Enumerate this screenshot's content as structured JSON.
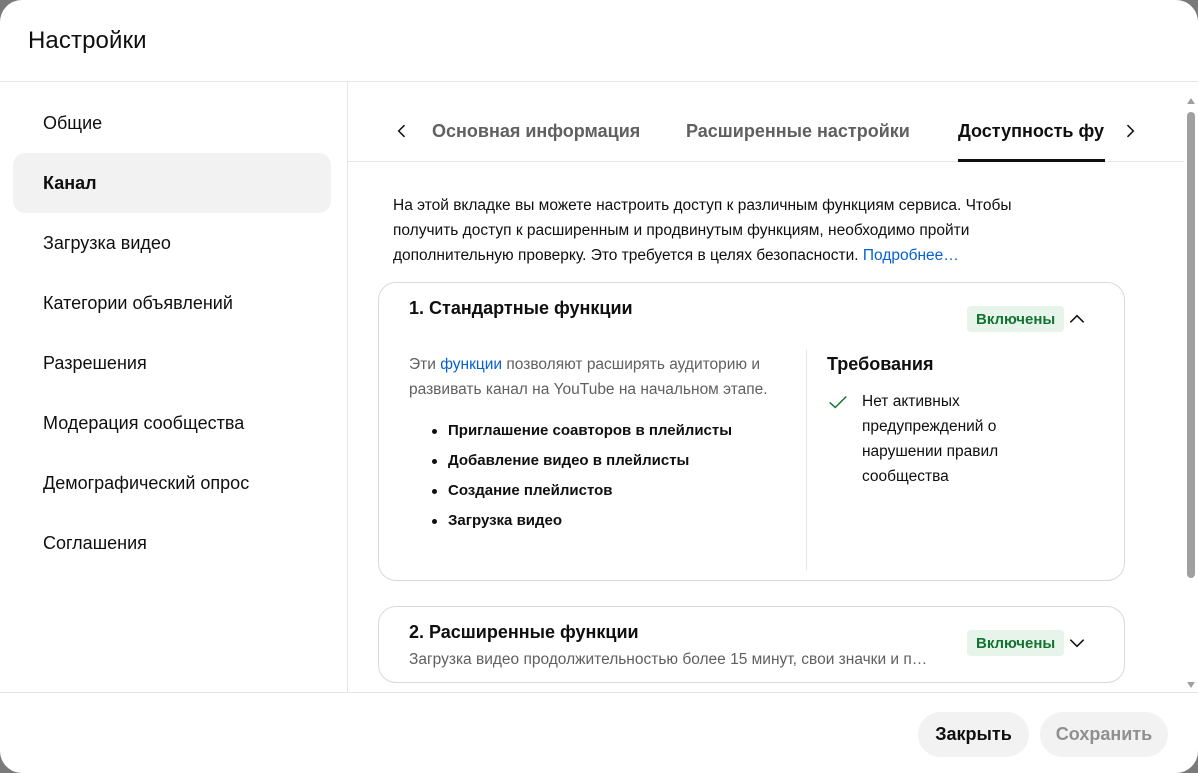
{
  "dialog": {
    "title": "Настройки"
  },
  "sidebar": {
    "items": [
      {
        "label": "Общие",
        "active": false
      },
      {
        "label": "Канал",
        "active": true
      },
      {
        "label": "Загрузка видео",
        "active": false
      },
      {
        "label": "Категории объявлений",
        "active": false
      },
      {
        "label": "Разрешения",
        "active": false
      },
      {
        "label": "Модерация сообщества",
        "active": false
      },
      {
        "label": "Демографический опрос",
        "active": false
      },
      {
        "label": "Соглашения",
        "active": false
      }
    ]
  },
  "tabs": {
    "items": [
      {
        "label": "Основная информация"
      },
      {
        "label": "Расширенные настройки"
      },
      {
        "label": "Доступность функций",
        "active": true
      }
    ]
  },
  "intro": {
    "text": "На этой вкладке вы можете настроить доступ к различным функциям сервиса. Чтобы получить доступ к расширенным и продвинутым функциям, необходимо пройти дополнительную проверку. Это требуется в целях безопасности.",
    "link": "Подробнее…"
  },
  "cards": {
    "standard": {
      "title": "1. Стандартные функции",
      "status": "Включены",
      "desc_before": "Эти ",
      "desc_link": "функции",
      "desc_after": " позволяют расширять аудиторию и развивать канал на YouTube на начальном этапе.",
      "features": [
        "Приглашение соавторов в плейлисты",
        "Добавление видео в плейлисты",
        "Создание плейлистов",
        "Загрузка видео"
      ],
      "requirements_title": "Требования",
      "requirement": "Нет активных предупреждений о нарушении правил сообщества"
    },
    "advanced": {
      "title": "2. Расширенные функции",
      "status": "Включены",
      "desc": "Загрузка видео продолжительностью более 15 минут, свои значки и п…"
    }
  },
  "footer": {
    "close_label": "Закрыть",
    "save_label": "Сохранить"
  },
  "colors": {
    "status_bg": "#e6f4ea",
    "status_text": "#137333",
    "link": "#065fd4",
    "check": "#137333"
  }
}
